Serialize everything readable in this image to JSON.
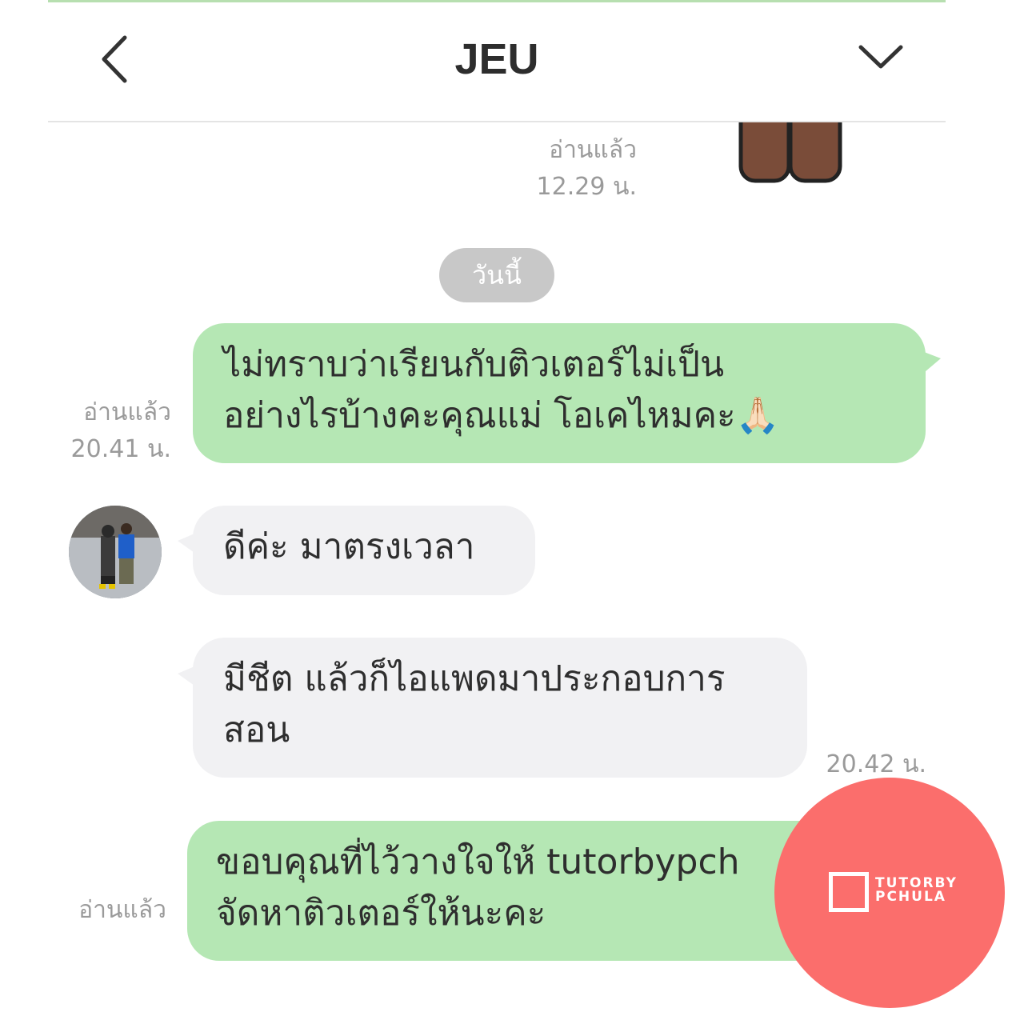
{
  "header": {
    "title": "JEU"
  },
  "messages": {
    "earlier": {
      "read": "อ่านแล้ว",
      "time": "12.29 น."
    },
    "date_divider": "วันนี้",
    "m1": {
      "lines": [
        "ไม่ทราบว่าเรียนกับติวเตอร์ไม่เป็น",
        "อย่างไรบ้างคะคุณแม่ โอเคไหมคะ🙏🏻"
      ],
      "read": "อ่านแล้ว",
      "time": "20.41 น."
    },
    "m2": {
      "text": "ดีค่ะ มาตรงเวลา"
    },
    "m3": {
      "lines": [
        "มีชีต แล้วก็ไอแพดมาประกอบการ",
        "สอน"
      ],
      "time": "20.42 น."
    },
    "m4": {
      "lines": [
        "ขอบคุณที่ไว้วางใจให้ tutorbypch",
        "จัดหาติวเตอร์ให้นะคะ"
      ],
      "read": "อ่านแล้ว"
    }
  },
  "watermark": {
    "line1": "TUTORBY",
    "line2": "PCHULA"
  },
  "colors": {
    "outgoing_bubble": "#b5e7b4",
    "incoming_bubble": "#f1f1f3",
    "badge": "#fb6e6c",
    "date_pill": "#c8c8c8"
  }
}
